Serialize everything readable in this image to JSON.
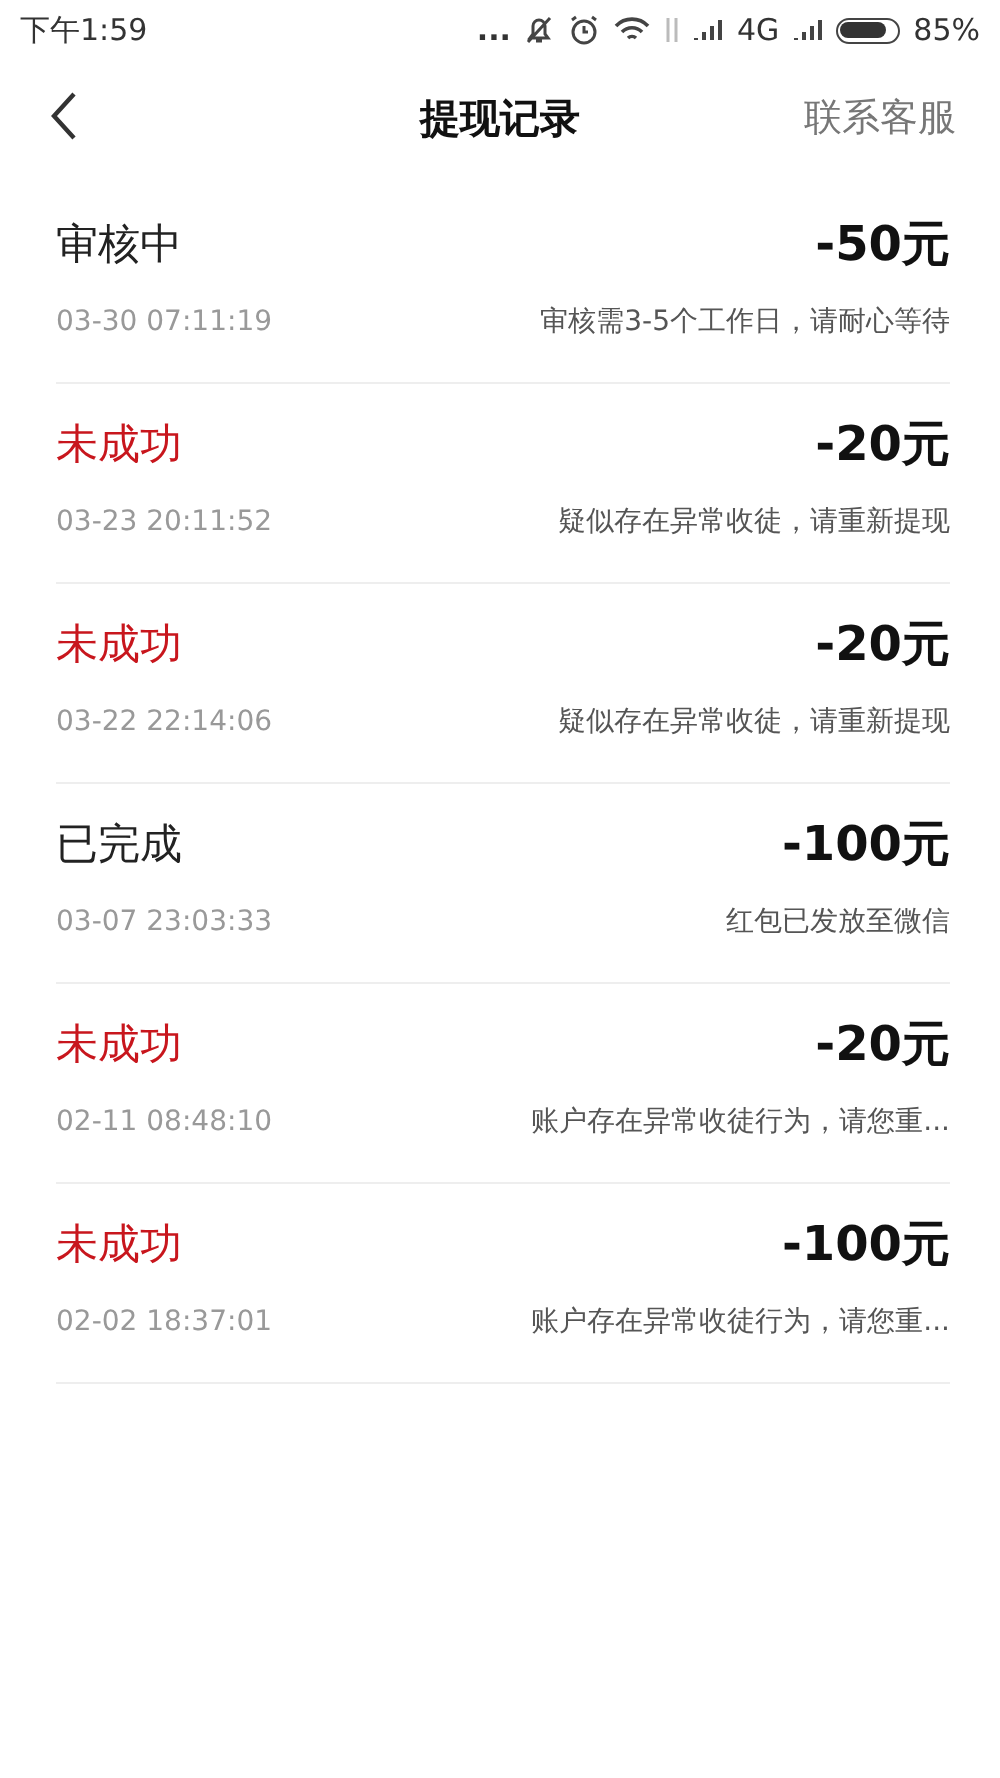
{
  "status_bar": {
    "time": "下午1:59",
    "dots": "...",
    "network": "4G",
    "battery": "85%"
  },
  "nav": {
    "title": "提现记录",
    "action": "联系客服"
  },
  "records": [
    {
      "status": "审核中",
      "kind": "pending",
      "amount": "-50元",
      "time": "03-30 07:11:19",
      "note": "审核需3-5个工作日，请耐心等待"
    },
    {
      "status": "未成功",
      "kind": "failed",
      "amount": "-20元",
      "time": "03-23 20:11:52",
      "note": "疑似存在异常收徒，请重新提现"
    },
    {
      "status": "未成功",
      "kind": "failed",
      "amount": "-20元",
      "time": "03-22 22:14:06",
      "note": "疑似存在异常收徒，请重新提现"
    },
    {
      "status": "已完成",
      "kind": "done",
      "amount": "-100元",
      "time": "03-07 23:03:33",
      "note": "红包已发放至微信"
    },
    {
      "status": "未成功",
      "kind": "failed",
      "amount": "-20元",
      "time": "02-11 08:48:10",
      "note": "账户存在异常收徒行为，请您重..."
    },
    {
      "status": "未成功",
      "kind": "failed",
      "amount": "-100元",
      "time": "02-02 18:37:01",
      "note": "账户存在异常收徒行为，请您重..."
    }
  ]
}
